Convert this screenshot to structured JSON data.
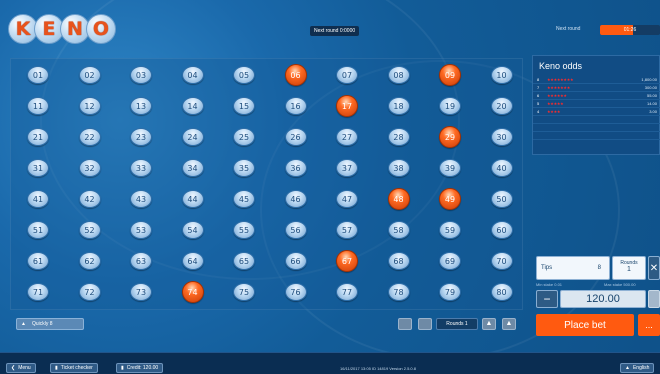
{
  "logo": {
    "letters": [
      "K",
      "E",
      "N",
      "O"
    ]
  },
  "header": {
    "next_round_label": "Next round 0:0000",
    "nr_label": "Next round",
    "nr_value": "01:26",
    "nr_progress": 0.55
  },
  "board": {
    "numbers": [
      "01",
      "02",
      "03",
      "04",
      "05",
      "06",
      "07",
      "08",
      "09",
      "10",
      "11",
      "12",
      "13",
      "14",
      "15",
      "16",
      "17",
      "18",
      "19",
      "20",
      "21",
      "22",
      "23",
      "24",
      "25",
      "26",
      "27",
      "28",
      "29",
      "30",
      "31",
      "32",
      "33",
      "34",
      "35",
      "36",
      "37",
      "38",
      "39",
      "40",
      "41",
      "42",
      "43",
      "44",
      "45",
      "46",
      "47",
      "48",
      "49",
      "50",
      "51",
      "52",
      "53",
      "54",
      "55",
      "56",
      "57",
      "58",
      "59",
      "60",
      "61",
      "62",
      "63",
      "64",
      "65",
      "66",
      "67",
      "68",
      "69",
      "70",
      "71",
      "72",
      "73",
      "74",
      "75",
      "76",
      "77",
      "78",
      "79",
      "80"
    ],
    "selected": [
      "06",
      "09",
      "17",
      "29",
      "48",
      "49",
      "67",
      "74"
    ]
  },
  "controls": {
    "quick_pick_label": "Quickly 8",
    "rounds_label": "Rounds",
    "rounds_value": "1"
  },
  "odds": {
    "title": "Keno odds",
    "rows": [
      {
        "hits": "8",
        "stars": "★★★★★★★★",
        "value": "1,800.00"
      },
      {
        "hits": "7",
        "stars": "★★★★★★★",
        "value": "300.00"
      },
      {
        "hits": "6",
        "stars": "★★★★★★",
        "value": "55.00"
      },
      {
        "hits": "5",
        "stars": "★★★★★",
        "value": "14.00"
      },
      {
        "hits": "4",
        "stars": "★★★★",
        "value": "3.00"
      }
    ]
  },
  "bet": {
    "tips_label": "Tips",
    "tips_value": "8",
    "rounds_label": "Rounds",
    "rounds_value": "1",
    "min_label": "Min stake 0.01",
    "max_label": "Max stake 500.00",
    "stake": "120.00",
    "place_label": "Place bet",
    "more_label": "..."
  },
  "footer": {
    "menu_label": "Menu",
    "ticket_label": "Ticket checker",
    "credit_label": "Credit: 120.00",
    "status_text": "16/11/2017 13:05   ID 14819   Version 2.5.0.8",
    "lang_label": "English"
  },
  "colors": {
    "accent": "#ff5a10",
    "background": "#0d4f86"
  }
}
